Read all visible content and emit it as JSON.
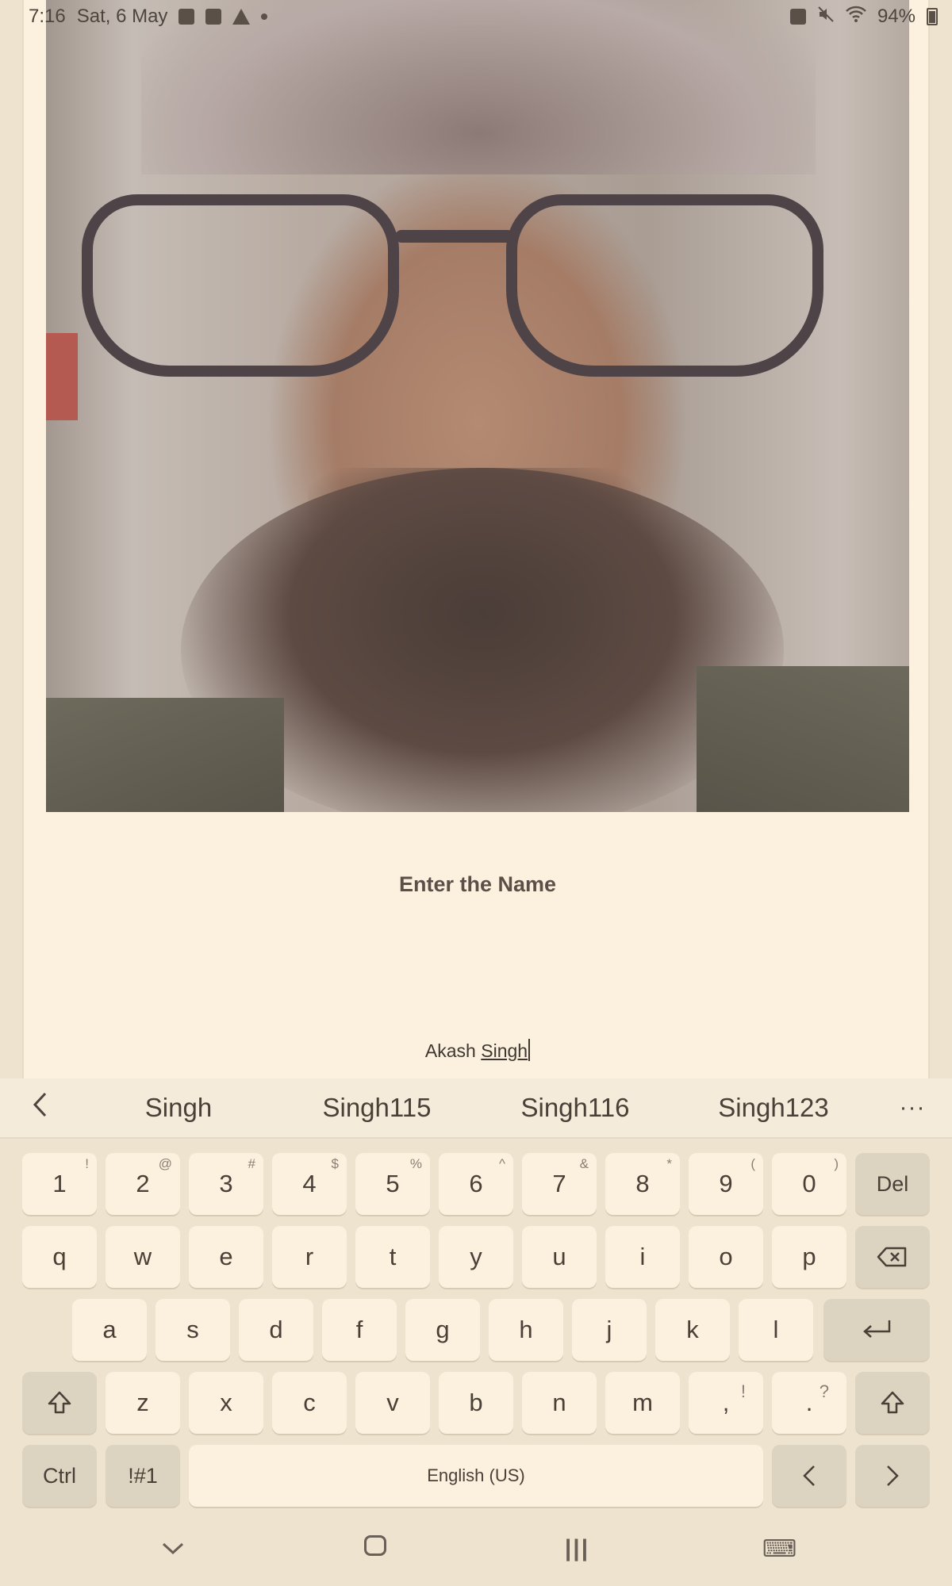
{
  "status_bar": {
    "time": "7:16",
    "date": "Sat, 6 May",
    "battery": "94%"
  },
  "screen": {
    "prompt_label": "Enter the Name",
    "name_input": {
      "value_prefix": "Akash ",
      "composing_word": "Singh"
    }
  },
  "suggestions": {
    "items": [
      "Singh",
      "Singh115",
      "Singh116",
      "Singh123"
    ],
    "more_label": "···",
    "back_label": "‹"
  },
  "keyboard": {
    "number_row": [
      {
        "label": "1",
        "hint": "!"
      },
      {
        "label": "2",
        "hint": "@"
      },
      {
        "label": "3",
        "hint": "#"
      },
      {
        "label": "4",
        "hint": "$"
      },
      {
        "label": "5",
        "hint": "%"
      },
      {
        "label": "6",
        "hint": "^"
      },
      {
        "label": "7",
        "hint": "&"
      },
      {
        "label": "8",
        "hint": "*"
      },
      {
        "label": "9",
        "hint": "("
      },
      {
        "label": "0",
        "hint": ")"
      }
    ],
    "del_label": "Del",
    "row_q": [
      "q",
      "w",
      "e",
      "r",
      "t",
      "y",
      "u",
      "i",
      "o",
      "p"
    ],
    "row_a": [
      "a",
      "s",
      "d",
      "f",
      "g",
      "h",
      "j",
      "k",
      "l"
    ],
    "row_z": [
      "z",
      "x",
      "c",
      "v",
      "b",
      "n",
      "m"
    ],
    "comma": {
      "label": ",",
      "hint": "!"
    },
    "period": {
      "label": ".",
      "hint": "?"
    },
    "ctrl_label": "Ctrl",
    "symbols_label": "!#1",
    "space_label": "English (US)",
    "left_arrow": "<",
    "right_arrow": ">",
    "backspace_icon": "⌫",
    "enter_icon": "↵",
    "shift_icon": "⇧"
  },
  "icons": {
    "nav_back": "⌄",
    "nav_recents": "|||",
    "nav_keyboard": "⌨"
  },
  "colors": {
    "background": "#ede3cf",
    "app_surface": "#fcf1df",
    "key_face": "#fcf1df",
    "function_key": "#ddd3c1",
    "text": "#4a4038"
  }
}
